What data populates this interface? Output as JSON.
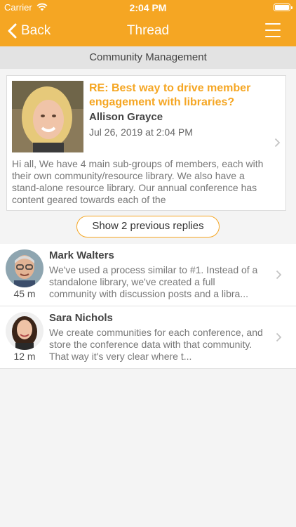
{
  "status_bar": {
    "carrier": "Carrier",
    "time": "2:04 PM"
  },
  "nav": {
    "back_label": "Back",
    "title": "Thread"
  },
  "subheader": "Community Management",
  "post": {
    "title": "RE: Best way to drive member engagement with libraries?",
    "author": "Allison Grayce",
    "date": "Jul 26, 2019 at 2:04 PM",
    "body": "Hi all, We have 4 main sub-groups of members, each with their own community/resource library. We also have a stand-alone resource library. Our annual conference has content geared towards each of the"
  },
  "show_previous_label": "Show 2 previous replies",
  "replies": [
    {
      "name": "Mark Walters",
      "ago": "45 m",
      "text": "We've used a process similar to #1. Instead of a standalone library, we've created a full community with discussion posts and a libra..."
    },
    {
      "name": "Sara Nichols",
      "ago": "12 m",
      "text": "We create communities for each conference, and store the conference data with that community.  That way it's very clear where t..."
    }
  ],
  "colors": {
    "accent": "#f5a623",
    "subheader_bg": "#e3e3e3",
    "page_bg": "#f4f4f4"
  }
}
